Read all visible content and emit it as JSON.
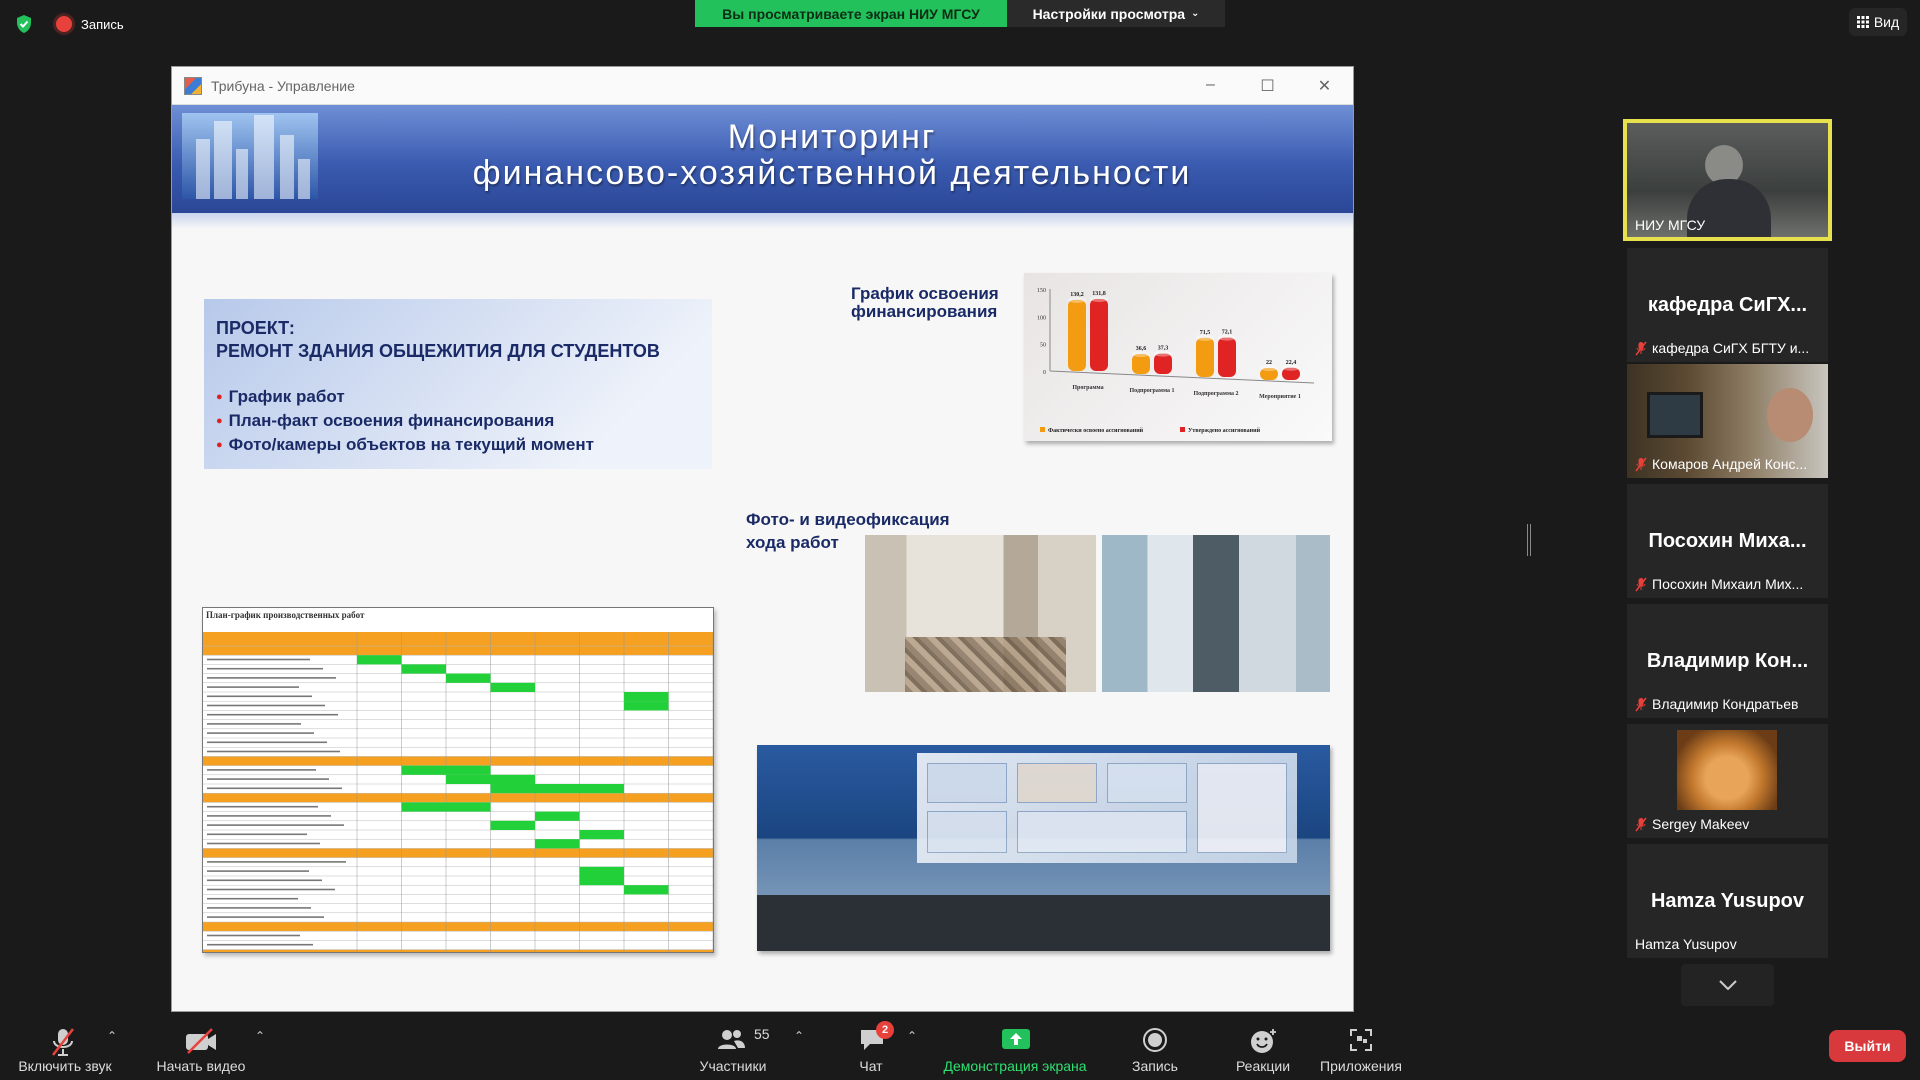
{
  "topbar": {
    "recording_label": "Запись",
    "share_banner": "Вы просматриваете экран НИУ МГСУ",
    "view_options": "Настройки просмотра",
    "view_button": "Вид"
  },
  "shared_window": {
    "title": "Трибуна - Управление",
    "controls": [
      "–",
      "☐",
      "✕"
    ]
  },
  "slide": {
    "header_line1": "Мониторинг",
    "header_line2": "финансово-хозяйственной деятельности",
    "project_title": "ПРОЕКТ:",
    "project_name": "РЕМОНТ ЗДАНИЯ ОБЩЕЖИТИЯ ДЛЯ СТУДЕНТОВ",
    "bullets": [
      "График работ",
      "План-факт освоения финансирования",
      "Фото/камеры объектов на текущий момент"
    ],
    "fin_label_line1": "График освоения",
    "fin_label_line2": "финансирования",
    "photo_label_line1": "Фото- и видеофиксация",
    "photo_label_line2": "хода работ",
    "gantt_title": "План-график производственных работ"
  },
  "chart_data": {
    "type": "bar",
    "categories": [
      "Программа",
      "Подпрограмма 1",
      "Подпрограмма 2",
      "Мероприятие 1"
    ],
    "series": [
      {
        "name": "Фактически освоено ассигнований",
        "values": [
          130.2,
          36.6,
          71.5,
          22
        ]
      },
      {
        "name": "Утверждено ассигнований",
        "values": [
          131.8,
          37.3,
          72.1,
          22.4
        ]
      }
    ],
    "ylim": [
      0,
      150
    ],
    "yticks": [
      0,
      50,
      100,
      150
    ],
    "colors": [
      "#f39c12",
      "#e02424"
    ]
  },
  "participants": [
    {
      "video_label": "НИУ МГСУ",
      "active": true
    },
    {
      "big_name": "кафедра СиГХ...",
      "label": "кафедра СиГХ БГТУ и..."
    },
    {
      "label": "Комаров Андрей Конс..."
    },
    {
      "big_name": "Посохин Миха...",
      "label": "Посохин Михаил Мих..."
    },
    {
      "big_name": "Владимир Кон...",
      "label": "Владимир Кондратьев"
    },
    {
      "label": "Sergey Makeev"
    },
    {
      "big_name": "Hamza Yusupov",
      "label": "Hamza Yusupov"
    }
  ],
  "toolbar": {
    "unmute": "Включить звук",
    "start_video": "Начать видео",
    "participants": "Участники",
    "participants_count": "55",
    "chat": "Чат",
    "chat_badge": "2",
    "share_screen": "Демонстрация экрана",
    "record": "Запись",
    "reactions": "Реакции",
    "apps": "Приложения",
    "leave": "Выйти"
  }
}
